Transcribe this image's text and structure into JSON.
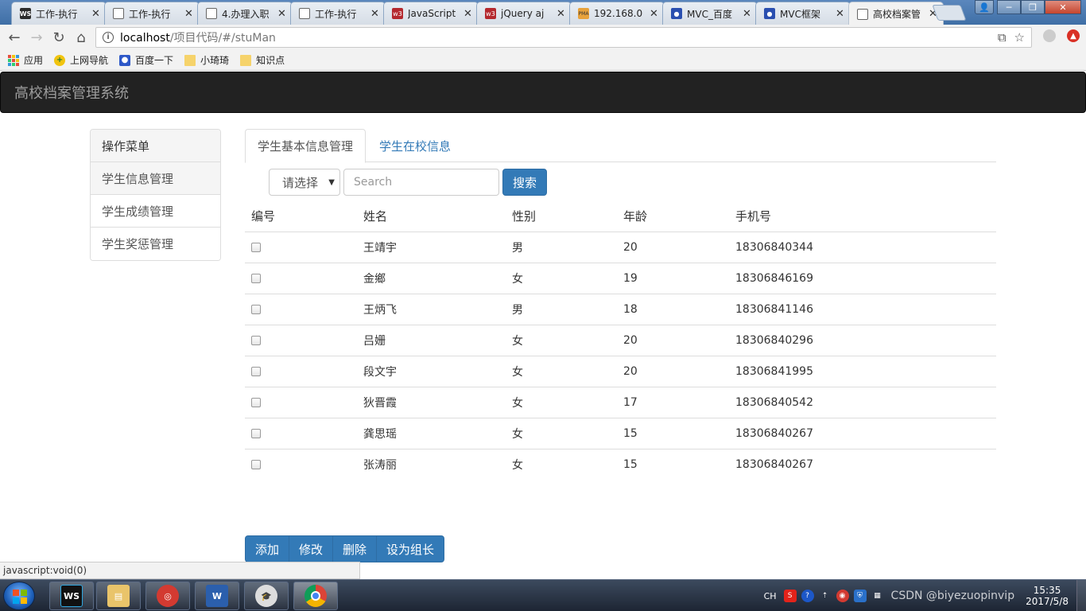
{
  "browser": {
    "tabs": [
      {
        "title": "工作-执行",
        "icon": "webstorm-icon"
      },
      {
        "title": "工作-执行",
        "icon": "document-icon"
      },
      {
        "title": "4.办理入职",
        "icon": "document-icon"
      },
      {
        "title": "工作-执行",
        "icon": "document-icon"
      },
      {
        "title": "JavaScript",
        "icon": "w3-icon"
      },
      {
        "title": "jQuery aj",
        "icon": "w3-icon"
      },
      {
        "title": "192.168.0",
        "icon": "phpmyadmin-icon"
      },
      {
        "title": "MVC_百度",
        "icon": "baidu-paw-icon"
      },
      {
        "title": "MVC框架",
        "icon": "baidu-paw-icon"
      },
      {
        "title": "高校档案管",
        "icon": "document-icon"
      }
    ],
    "address": {
      "host": "localhost",
      "path": "/项目代码/#/stuMan"
    },
    "bookmarks": [
      {
        "label": "应用",
        "icon": "apps-icon"
      },
      {
        "label": "上网导航",
        "icon": "navigation-icon"
      },
      {
        "label": "百度一下",
        "icon": "baidu-paw-icon"
      },
      {
        "label": "小琦琦",
        "icon": "folder-icon"
      },
      {
        "label": "知识点",
        "icon": "folder-icon"
      }
    ],
    "status_text": "javascript:void(0)"
  },
  "app": {
    "brand": "高校档案管理系统",
    "sidebar": {
      "heading": "操作菜单",
      "items": [
        {
          "label": "学生信息管理",
          "active": true
        },
        {
          "label": "学生成绩管理",
          "active": false
        },
        {
          "label": "学生奖惩管理",
          "active": false
        }
      ]
    },
    "tabs": [
      {
        "label": "学生基本信息管理",
        "active": true
      },
      {
        "label": "学生在校信息",
        "active": false
      }
    ],
    "search": {
      "select_value": "请选择",
      "placeholder": "Search",
      "button_label": "搜索"
    },
    "table": {
      "headers": [
        "编号",
        "姓名",
        "性别",
        "年龄",
        "手机号"
      ],
      "rows": [
        {
          "name": "王靖宇",
          "gender": "男",
          "age": "20",
          "phone": "18306840344"
        },
        {
          "name": "金鄉",
          "gender": "女",
          "age": "19",
          "phone": "18306846169"
        },
        {
          "name": "王炳飞",
          "gender": "男",
          "age": "18",
          "phone": "18306841146"
        },
        {
          "name": "吕姗",
          "gender": "女",
          "age": "20",
          "phone": "18306840296"
        },
        {
          "name": "段文宇",
          "gender": "女",
          "age": "20",
          "phone": "18306841995"
        },
        {
          "name": "狄晋霞",
          "gender": "女",
          "age": "17",
          "phone": "18306840542"
        },
        {
          "name": "龚思瑶",
          "gender": "女",
          "age": "15",
          "phone": "18306840267"
        },
        {
          "name": "张涛丽",
          "gender": "女",
          "age": "15",
          "phone": "18306840267"
        }
      ]
    },
    "actions": [
      "添加",
      "修改",
      "删除",
      "设为组长"
    ]
  },
  "taskbar": {
    "apps": [
      "webstorm",
      "file-explorer",
      "netease-music",
      "word",
      "graduation-app",
      "chrome"
    ],
    "ime": "CH",
    "watermark": "CSDN @biyezuopinvip",
    "time": "15:35",
    "date": "2017/5/8"
  },
  "colors": {
    "primary": "#337ab7",
    "navbar": "#222222",
    "brand_text": "#9d9d9d"
  }
}
